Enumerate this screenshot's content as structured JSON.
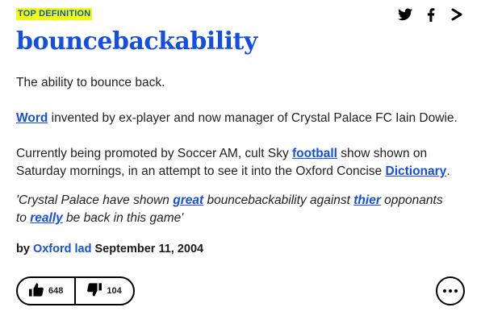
{
  "badge": "TOP DEFINITION",
  "icons": {
    "twitter": "twitter-icon",
    "facebook": "facebook-icon",
    "share": "share-icon"
  },
  "word": "bouncebackability",
  "meaning": {
    "p1": "The ability to bounce back.",
    "p2_link": "Word",
    "p2_rest": " invented by ex-player and now manager of Crystal Palace FC Iain Dowie.",
    "p3_a": "Currently being promoted by Soccer AM, cult Sky ",
    "p3_link1": "football",
    "p3_b": " show shown on Saturday mornings, in an attempt to see it into the Oxford Concise ",
    "p3_link2": "Dictionary",
    "p3_c": "."
  },
  "example": {
    "a": "'Crystal Palace have shown ",
    "link1": "great",
    "b": " bouncebackability against ",
    "link2": "thier",
    "c": " opponants to ",
    "link3": "really",
    "d": " be back in this game'"
  },
  "contributor": {
    "by": "by ",
    "author": "Oxford lad",
    "date": " September 11, 2004"
  },
  "votes": {
    "up": "648",
    "down": "104"
  },
  "colors": {
    "accent": "#134fe6",
    "badge_bg": "#efff00"
  }
}
